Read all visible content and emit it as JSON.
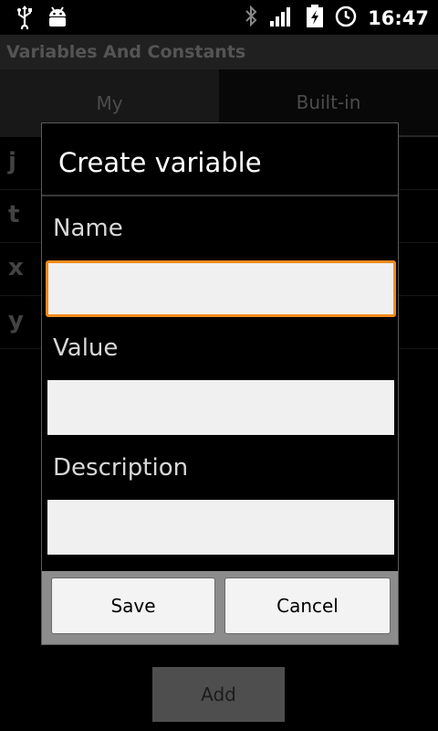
{
  "status_bar": {
    "icons": [
      "usb-icon",
      "android-debug-icon",
      "bluetooth-icon",
      "signal-icon",
      "battery-charging-icon",
      "alarm-clock-icon"
    ],
    "time": "16:47"
  },
  "app": {
    "title": "Variables And Constants"
  },
  "tabs": [
    {
      "label": "My",
      "selected": true
    },
    {
      "label": "Built-in",
      "selected": false
    }
  ],
  "list": {
    "items": [
      {
        "label": "j"
      },
      {
        "label": "t"
      },
      {
        "label": "x"
      },
      {
        "label": "y"
      }
    ]
  },
  "dialog": {
    "title": "Create variable",
    "fields": [
      {
        "label": "Name",
        "value": "",
        "focused": true
      },
      {
        "label": "Value",
        "value": ""
      },
      {
        "label": "Description",
        "value": ""
      }
    ],
    "save_label": "Save",
    "cancel_label": "Cancel"
  },
  "add_label": "Add",
  "colors": {
    "focus": "#f08a1c",
    "title_bar": "#3b3b3b"
  }
}
